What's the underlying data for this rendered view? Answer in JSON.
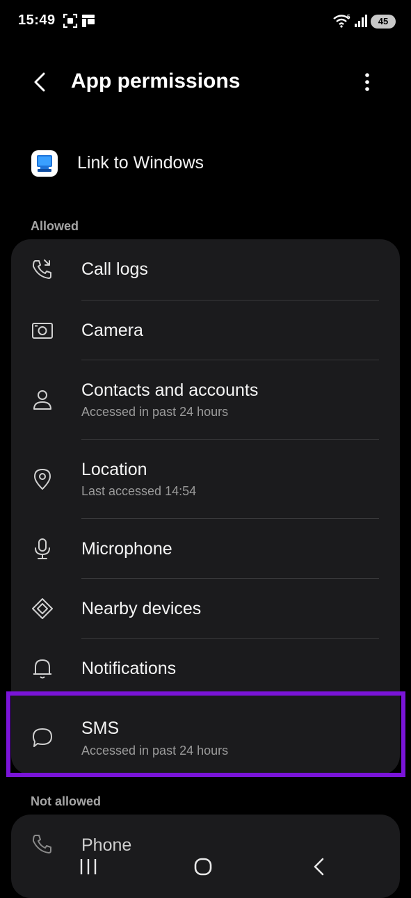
{
  "status_bar": {
    "time": "15:49",
    "battery": "45",
    "icons": [
      "screenshot-icon",
      "device-icon",
      "wifi-icon",
      "signal-icon"
    ]
  },
  "app_bar": {
    "title": "App permissions",
    "back_icon": "back-arrow-icon",
    "more_icon": "more-vert-icon"
  },
  "app": {
    "name": "Link to Windows",
    "icon": "link-to-windows-icon"
  },
  "sections": {
    "allowed_label": "Allowed",
    "not_allowed_label": "Not allowed"
  },
  "allowed": [
    {
      "label": "Call logs",
      "sub": "",
      "icon": "call-log-icon"
    },
    {
      "label": "Camera",
      "sub": "",
      "icon": "camera-icon"
    },
    {
      "label": "Contacts and accounts",
      "sub": "Accessed in past 24 hours",
      "icon": "person-icon"
    },
    {
      "label": "Location",
      "sub": "Last accessed 14:54",
      "icon": "location-pin-icon"
    },
    {
      "label": "Microphone",
      "sub": "",
      "icon": "microphone-icon"
    },
    {
      "label": "Nearby devices",
      "sub": "",
      "icon": "nearby-devices-icon"
    },
    {
      "label": "Notifications",
      "sub": "",
      "icon": "bell-icon"
    },
    {
      "label": "SMS",
      "sub": "Accessed in past 24 hours",
      "icon": "message-bubble-icon"
    }
  ],
  "not_allowed": [
    {
      "label": "Phone",
      "icon": "phone-icon"
    }
  ],
  "nav_bar": {
    "icons": [
      "recents-icon",
      "home-icon",
      "back-icon"
    ]
  },
  "colors": {
    "background": "#000000",
    "card": "#1b1b1d",
    "highlight": "#7a14d8",
    "secondary_text": "#9a9a9a"
  }
}
